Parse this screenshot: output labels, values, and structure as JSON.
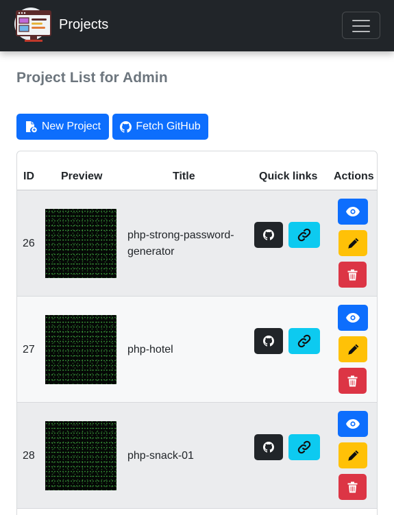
{
  "navbar": {
    "brand": "Projects",
    "toggler_icon": "hamburger-icon",
    "logo_icon": "code-window-logo"
  },
  "page": {
    "title": "Project List for Admin"
  },
  "toolbar": {
    "new_project_label": "New Project",
    "new_project_icon": "file-plus-icon",
    "fetch_github_label": "Fetch GitHub",
    "fetch_github_icon": "github-icon"
  },
  "table": {
    "headers": [
      "ID",
      "Preview",
      "Title",
      "Quick links",
      "Actions"
    ],
    "rows": [
      {
        "id": "26",
        "title_line1": "php-strong-password-",
        "title_line2": "generator"
      },
      {
        "id": "27",
        "title_line1": "php-hotel",
        "title_line2": ""
      },
      {
        "id": "28",
        "title_line1": "php-snack-01",
        "title_line2": ""
      }
    ]
  },
  "colors": {
    "navbar_bg": "#212529",
    "primary": "#0d6efd",
    "info": "#0dcaf0",
    "warning": "#ffc107",
    "danger": "#dc3545",
    "dark": "#212529",
    "heading": "#6c757d"
  }
}
